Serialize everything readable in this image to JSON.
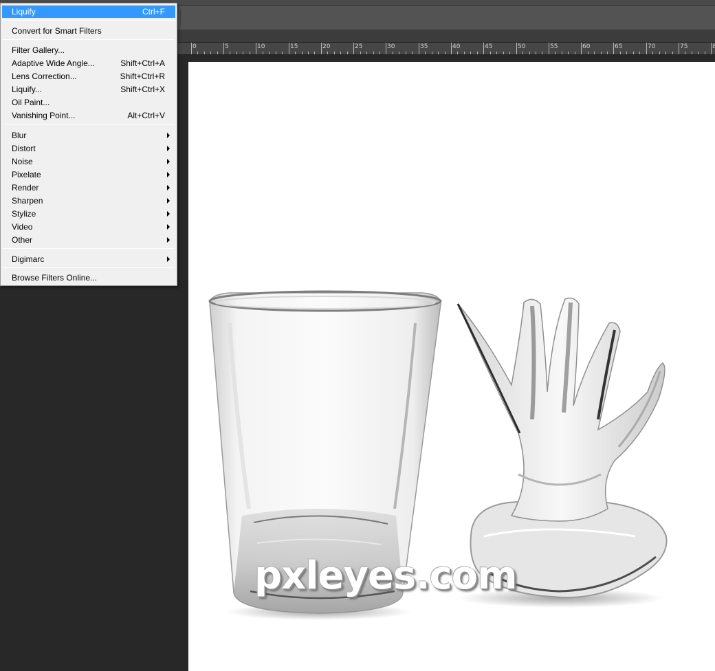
{
  "menu": {
    "items": [
      {
        "label": "Liquify",
        "shortcut": "Ctrl+F",
        "highlighted": true
      },
      {
        "label": "Convert for Smart Filters",
        "shortcut": ""
      },
      {
        "label": "Filter Gallery...",
        "shortcut": ""
      },
      {
        "label": "Adaptive Wide Angle...",
        "shortcut": "Shift+Ctrl+A"
      },
      {
        "label": "Lens Correction...",
        "shortcut": "Shift+Ctrl+R"
      },
      {
        "label": "Liquify...",
        "shortcut": "Shift+Ctrl+X"
      },
      {
        "label": "Oil Paint...",
        "shortcut": ""
      },
      {
        "label": "Vanishing Point...",
        "shortcut": "Alt+Ctrl+V"
      },
      {
        "label": "Blur",
        "submenu": true
      },
      {
        "label": "Distort",
        "submenu": true
      },
      {
        "label": "Noise",
        "submenu": true
      },
      {
        "label": "Pixelate",
        "submenu": true
      },
      {
        "label": "Render",
        "submenu": true
      },
      {
        "label": "Sharpen",
        "submenu": true
      },
      {
        "label": "Stylize",
        "submenu": true
      },
      {
        "label": "Video",
        "submenu": true
      },
      {
        "label": "Other",
        "submenu": true
      },
      {
        "label": "Digimarc",
        "submenu": true
      },
      {
        "label": "Browse Filters Online...",
        "shortcut": ""
      }
    ],
    "highlight_color": "#3399ff"
  },
  "ruler": {
    "labels": [
      "0",
      "5",
      "10",
      "15",
      "20",
      "25",
      "30",
      "35",
      "40",
      "45",
      "50",
      "55",
      "60",
      "65",
      "70",
      "75",
      "8"
    ]
  },
  "watermark": "pxleyes.com"
}
